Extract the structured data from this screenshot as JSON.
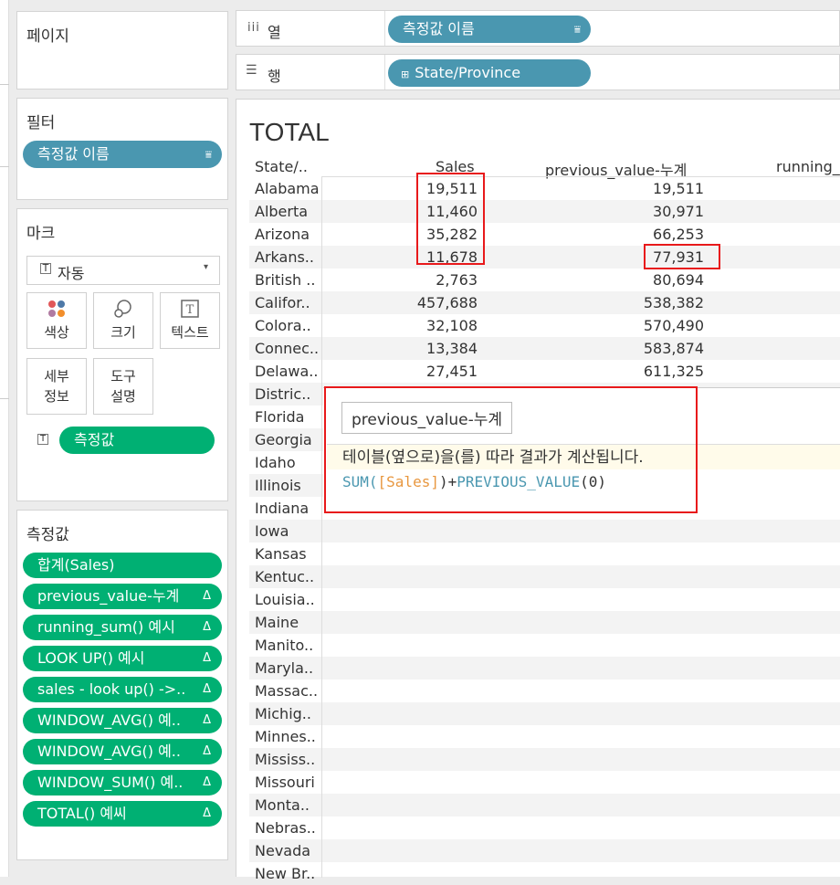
{
  "pages_panel": {
    "title": "페이지"
  },
  "filters_panel": {
    "title": "필터",
    "pill": "측정값 이름"
  },
  "marks_panel": {
    "title": "마크",
    "type_select": "자동",
    "buttons": {
      "color": "색상",
      "size": "크기",
      "text": "텍스트",
      "detail": [
        "세부",
        "정보"
      ],
      "tooltip": [
        "도구",
        "설명"
      ]
    },
    "text_pill": "측정값"
  },
  "measure_values": {
    "title": "측정값",
    "items": [
      "합계(Sales)",
      "previous_value-누계",
      "running_sum() 예시",
      "LOOK UP() 예시",
      "sales - look up() ->..",
      "WINDOW_AVG() 예..",
      "WINDOW_AVG() 예..",
      "WINDOW_SUM() 예..",
      "TOTAL() 예씨"
    ]
  },
  "shelves": {
    "columns": {
      "label": "열",
      "pill": "측정값 이름"
    },
    "rows": {
      "label": "행",
      "pill": "State/Province"
    }
  },
  "view": {
    "title": "TOTAL",
    "headers": [
      "State/..",
      "Sales",
      "previous_value-누계",
      "running_"
    ],
    "rows": [
      [
        "Alabama",
        "19,511",
        "19,511"
      ],
      [
        "Alberta",
        "11,460",
        "30,971"
      ],
      [
        "Arizona",
        "35,282",
        "66,253"
      ],
      [
        "Arkans..",
        "11,678",
        "77,931"
      ],
      [
        "British ..",
        "2,763",
        "80,694"
      ],
      [
        "Califor..",
        "457,688",
        "538,382"
      ],
      [
        "Colora..",
        "32,108",
        "570,490"
      ],
      [
        "Connec..",
        "13,384",
        "583,874"
      ],
      [
        "Delawa..",
        "27,451",
        "611,325"
      ],
      [
        "Distric..",
        "",
        ""
      ],
      [
        "Florida",
        "",
        ""
      ],
      [
        "Georgia",
        "",
        ""
      ],
      [
        "Idaho",
        "",
        ""
      ],
      [
        "Illinois",
        "",
        ""
      ],
      [
        "Indiana",
        "",
        ""
      ],
      [
        "Iowa",
        "",
        ""
      ],
      [
        "Kansas",
        "",
        ""
      ],
      [
        "Kentuc..",
        "",
        ""
      ],
      [
        "Louisia..",
        "",
        ""
      ],
      [
        "Maine",
        "",
        ""
      ],
      [
        "Manito..",
        "",
        ""
      ],
      [
        "Maryla..",
        "",
        ""
      ],
      [
        "Massac..",
        "",
        ""
      ],
      [
        "Michig..",
        "",
        ""
      ],
      [
        "Minnes..",
        "",
        ""
      ],
      [
        "Mississ..",
        "",
        ""
      ],
      [
        "Missouri",
        "",
        ""
      ],
      [
        "Monta..",
        "",
        ""
      ],
      [
        "Nebras..",
        "",
        ""
      ],
      [
        "Nevada",
        "",
        ""
      ],
      [
        "New Br..",
        "",
        ""
      ]
    ]
  },
  "tooltip": {
    "title": "previous_value-누계",
    "description": "테이블(옆으로)을(를) 따라 결과가 계산됩니다.",
    "formula": {
      "fn1": "SUM(",
      "field": "[Sales]",
      "plus": ")+",
      "fn2": "PREVIOUS_VALUE",
      "arg": "(0)"
    }
  },
  "colors": {
    "blue_pill": "#4a97b0",
    "green_pill": "#00b073",
    "highlight": "#e8191b"
  }
}
